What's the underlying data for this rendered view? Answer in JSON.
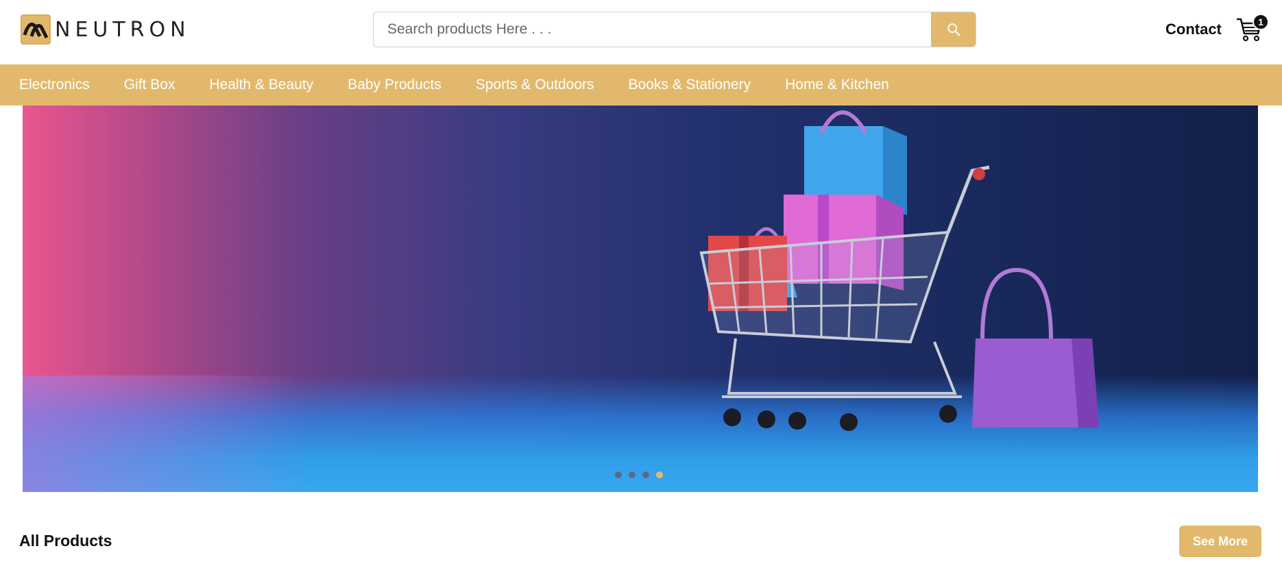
{
  "brand": {
    "name": "NEUTRON",
    "accent": "#e2b96c"
  },
  "search": {
    "placeholder": "Search products Here . . .",
    "value": ""
  },
  "header": {
    "contact_label": "Contact",
    "cart_count": "1"
  },
  "nav": {
    "items": [
      {
        "label": "Electronics"
      },
      {
        "label": "Gift Box"
      },
      {
        "label": "Health & Beauty"
      },
      {
        "label": "Baby Products"
      },
      {
        "label": "Sports & Outdoors"
      },
      {
        "label": "Books & Stationery"
      },
      {
        "label": "Home & Kitchen"
      }
    ]
  },
  "carousel": {
    "slide_count": 4,
    "active_index": 3
  },
  "products": {
    "section_title": "All Products",
    "see_more_label": "See More"
  },
  "icons": {
    "search": "search-icon",
    "cart": "cart-icon"
  }
}
